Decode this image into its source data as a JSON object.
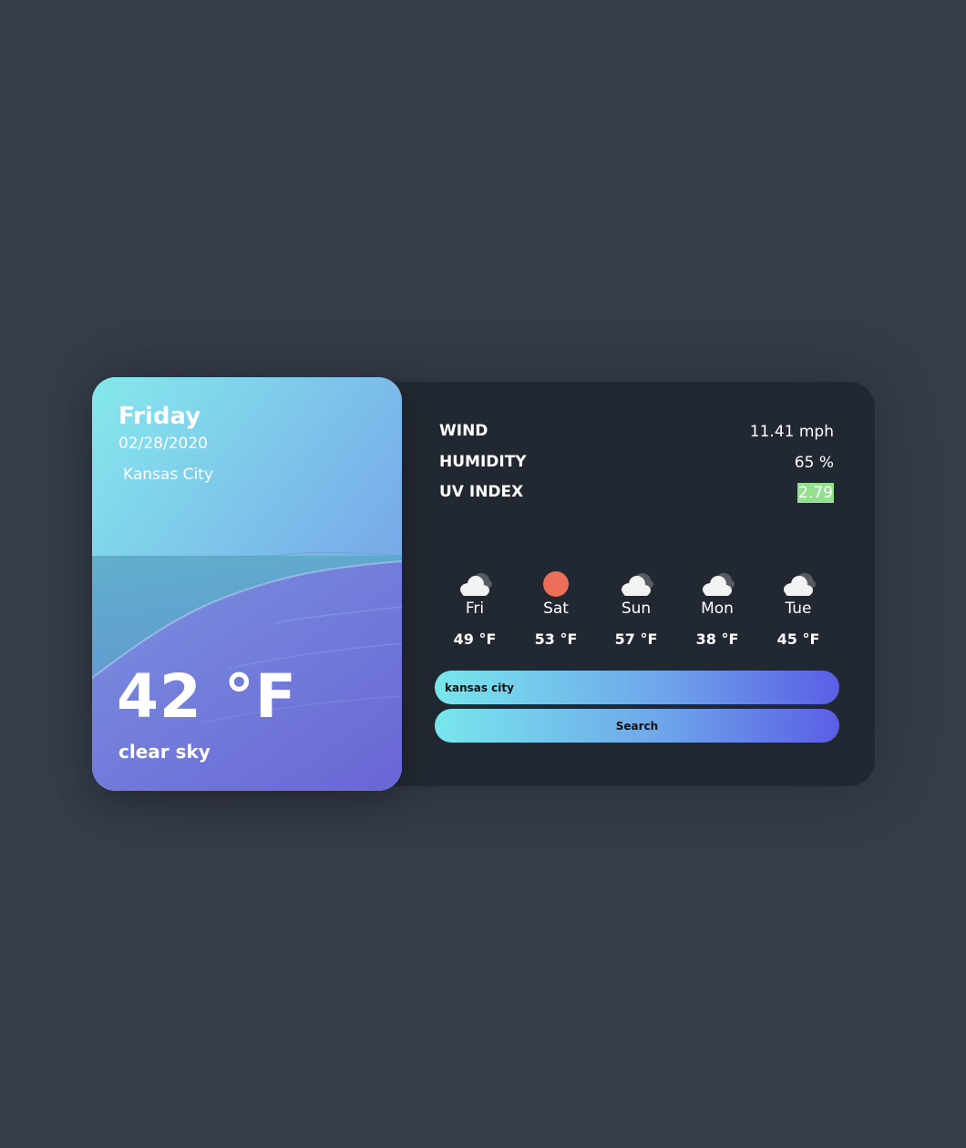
{
  "current": {
    "day": "Friday",
    "date": "02/28/2020",
    "city": "Kansas City",
    "temperature": "42 °F",
    "description": "clear sky"
  },
  "stats": {
    "wind_label": "WIND",
    "wind_value": "11.41 mph",
    "humidity_label": "HUMIDITY",
    "humidity_value": "65 %",
    "uv_label": "UV INDEX",
    "uv_value": "2.79",
    "uv_color": "#93e08f"
  },
  "forecast": [
    {
      "day": "Fri",
      "temp": "49 °F",
      "icon": "cloud-icon"
    },
    {
      "day": "Sat",
      "temp": "53 °F",
      "icon": "sun-icon"
    },
    {
      "day": "Sun",
      "temp": "57 °F",
      "icon": "cloud-icon"
    },
    {
      "day": "Mon",
      "temp": "38 °F",
      "icon": "cloud-icon"
    },
    {
      "day": "Tue",
      "temp": "45 °F",
      "icon": "cloud-icon"
    }
  ],
  "search": {
    "input_value": "kansas city",
    "button_label": "Search"
  },
  "colors": {
    "background": "#353c4a",
    "panel": "#222831",
    "sun": "#ec6e58",
    "gradient_start": "#78e6ec",
    "gradient_end": "#5a5ee5"
  }
}
